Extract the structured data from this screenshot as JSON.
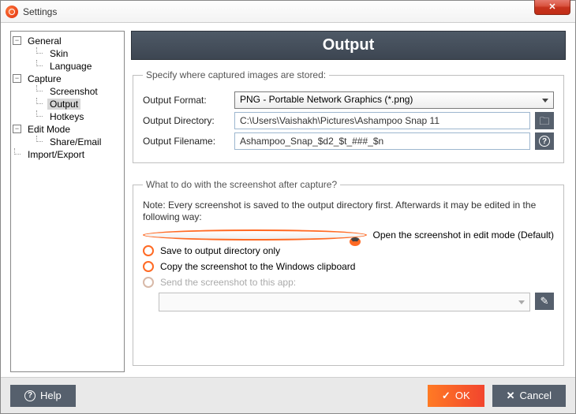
{
  "window": {
    "title": "Settings"
  },
  "tree": {
    "general": {
      "label": "General",
      "skin": "Skin",
      "language": "Language"
    },
    "capture": {
      "label": "Capture",
      "screenshot": "Screenshot",
      "output": "Output",
      "hotkeys": "Hotkeys"
    },
    "editmode": {
      "label": "Edit Mode",
      "share": "Share/Email"
    },
    "importexport": "Import/Export"
  },
  "banner": "Output",
  "storage": {
    "legend": "Specify where captured images are stored:",
    "format_label": "Output Format:",
    "format_value": "PNG - Portable Network Graphics (*.png)",
    "dir_label": "Output Directory:",
    "dir_value": "C:\\Users\\Vaishakh\\Pictures\\Ashampoo Snap 11",
    "file_label": "Output Filename:",
    "file_value": "Ashampoo_Snap_$d2_$t_###_$n"
  },
  "after": {
    "legend": "What to do with the screenshot after capture?",
    "note": "Note: Every screenshot is saved to the output directory first. Afterwards it may be edited in the following way:",
    "opt_edit": "Open the screenshot in edit mode (Default)",
    "opt_save": "Save to output directory only",
    "opt_clip": "Copy the screenshot to the Windows clipboard",
    "opt_app": "Send the screenshot to this app:"
  },
  "footer": {
    "help": "Help",
    "ok": "OK",
    "cancel": "Cancel"
  }
}
